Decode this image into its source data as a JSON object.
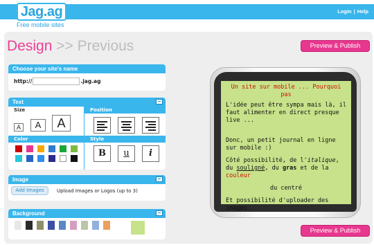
{
  "header": {
    "logo_text": "Jag.ag",
    "tagline": "Free mobile sites",
    "login": "Login",
    "separator": "|",
    "help": "Help"
  },
  "title": {
    "current": "Design",
    "separator": ">>",
    "previous": "Previous"
  },
  "buttons": {
    "preview_publish": "Preview & Publish"
  },
  "name_panel": {
    "heading": "Choose your site's name",
    "prefix": "http://",
    "value": "",
    "suffix": ".jag.ag"
  },
  "text_panel": {
    "heading": "Text",
    "size_label": "Size",
    "size_glyph": "A",
    "position_label": "Position",
    "color_label": "Color",
    "style_label": "Style",
    "bold": "B",
    "underline": "u",
    "italic": "i",
    "colors": [
      "#cc0000",
      "#e8378f",
      "#f7a800",
      "#2f7bd1",
      "#19a838",
      "#7dbb40",
      "#26c8d8",
      "#2563c7",
      "#2f8ef0",
      "#2a2a8a",
      "#ffffff",
      "#111111"
    ]
  },
  "image_panel": {
    "heading": "Image",
    "add_button": "Add Images",
    "description": "Upload Images or Logos (up to 3)"
  },
  "background_panel": {
    "heading": "Background",
    "colors": [
      "#e8e8e8",
      "#2a2a2a",
      "#8f8f6a",
      "#3c4fa5",
      "#5b87c5",
      "#d39fbf",
      "#b9c7a6",
      "#92b0de",
      "#eba15c",
      "#c7e28a"
    ]
  },
  "preview": {
    "title": "Un site sur mobile ... Pourquoi pas",
    "p1": "L'idée peut être sympa mais là, il faut alimenter en direct presque live ...",
    "p2": "Donc, un petit journal en ligne sur mobile :)",
    "p3_a": "Côté possibilité, de l'",
    "p3_italic": "italique",
    "p3_b": ", du",
    "p3_underline": "souligné",
    "p3_c": ", du",
    "p3_bold": "gras",
    "p3_d": "et de la",
    "p3_color": "couleur",
    "p4": "du centré",
    "p5": "Et possibilité d'uploader des images"
  }
}
